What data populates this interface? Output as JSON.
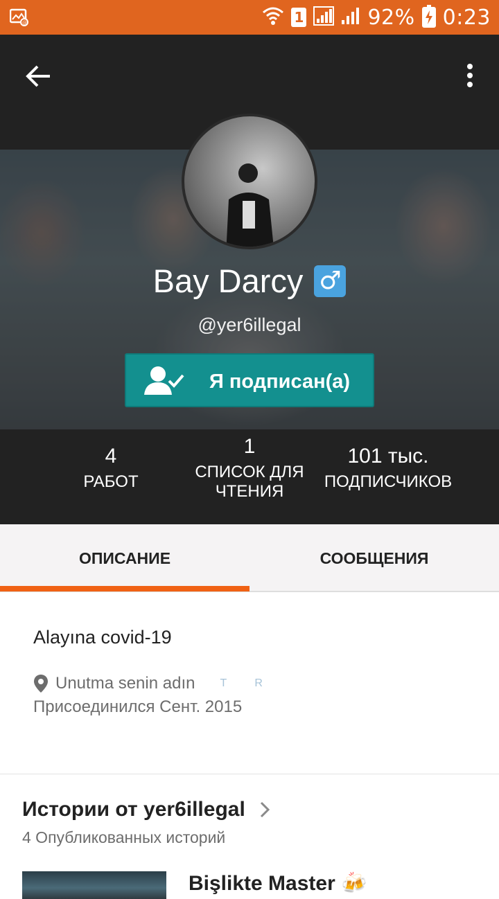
{
  "status_bar": {
    "sim": "1",
    "battery": "92%",
    "time": "0:23"
  },
  "profile": {
    "name": "Bay Darcy",
    "gender_badge": "♂",
    "handle": "@yer6illegal",
    "follow_label": "Я подписан(а)"
  },
  "stats": [
    {
      "value": "4",
      "label": "РАБОТ"
    },
    {
      "value": "1",
      "label_line1": "СПИСОК ДЛЯ",
      "label_line2": "ЧТЕНИЯ"
    },
    {
      "value": "101 тыс.",
      "label": "ПОДПИСЧИКОВ"
    }
  ],
  "tabs": [
    {
      "label": "ОПИСАНИЕ",
      "active": true
    },
    {
      "label": "СООБЩЕНИЯ",
      "active": false
    }
  ],
  "about": {
    "description": "Alayına covid-19",
    "location": "Unutma senin adın",
    "faint_marks": "T R",
    "joined": "Присоединился Сент. 2015"
  },
  "stories": {
    "title": "Истории от yer6illegal",
    "subtitle": "4 Опубликованных историй",
    "first_story_title": "Bişlikte Master 🍻"
  },
  "colors": {
    "status_bar": "#e0651f",
    "accent_orange": "#f06114",
    "follow_button": "#13908f",
    "header_bg": "#222222"
  }
}
